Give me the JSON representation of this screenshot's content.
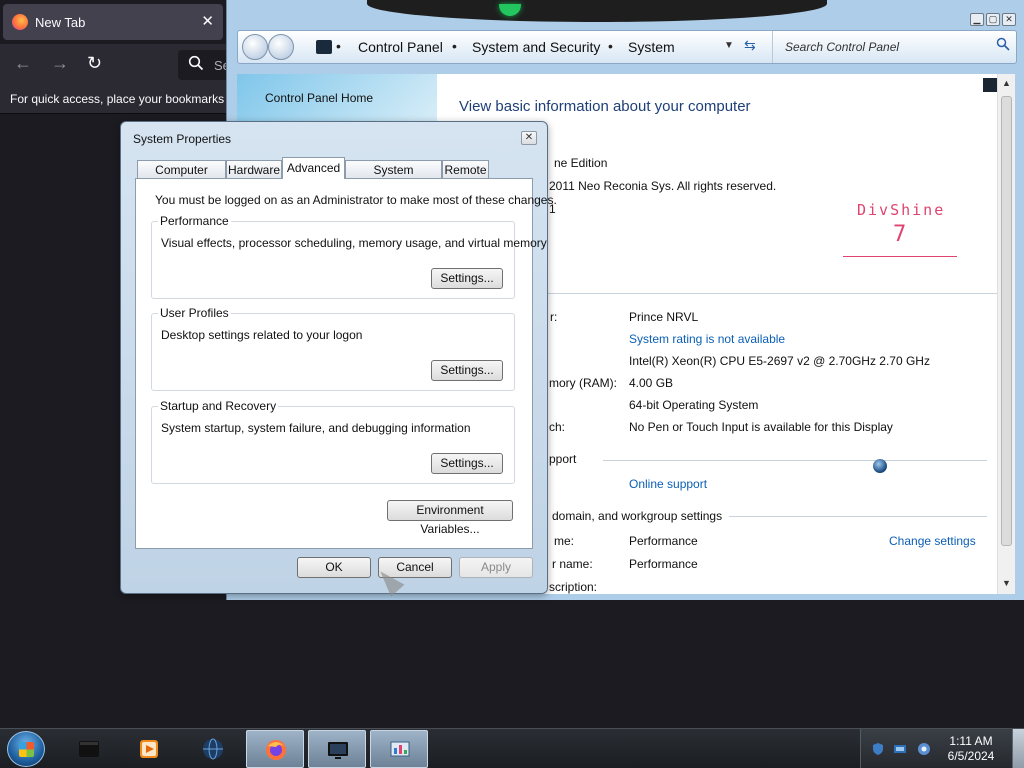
{
  "firefox": {
    "tab_title": "New Tab",
    "tab_close": "✕",
    "search_partial": "Se",
    "bookmarks_hint": "For quick access, place your bookmarks h"
  },
  "control_panel": {
    "breadcrumbs": [
      "Control Panel",
      "System and Security",
      "System"
    ],
    "search_placeholder": "Search Control Panel",
    "left_nav": {
      "home": "Control Panel Home"
    },
    "heading": "View basic information about your computer",
    "edition_fragment": "ne Edition",
    "copyright_fragment": "2011 Neo Reconia Sys.  All rights reserved.",
    "pack_fragment": "1",
    "logo": {
      "name": "DivShine",
      "version": "7"
    },
    "system_rows": [
      {
        "label": "r:",
        "value": "Prince NRVL",
        "link": false
      },
      {
        "label": "",
        "value": "System rating is not available",
        "link": true
      },
      {
        "label": "",
        "value": "Intel(R) Xeon(R) CPU E5-2697 v2 @ 2.70GHz   2.70 GHz",
        "link": false
      },
      {
        "label": "mory (RAM):",
        "value": "4.00 GB",
        "link": false
      },
      {
        "label": "",
        "value": "64-bit Operating System",
        "link": false
      },
      {
        "label": "ch:",
        "value": "No Pen or Touch Input is available for this Display",
        "link": false
      }
    ],
    "support_section": "pport",
    "support_link": "Online support",
    "domain_section": "domain, and workgroup settings",
    "domain_rows": [
      {
        "label": "me:",
        "value": "Performance"
      },
      {
        "label": "r name:",
        "value": "Performance"
      },
      {
        "label": "scription:",
        "value": ""
      }
    ],
    "change_settings": "Change settings"
  },
  "dialog": {
    "title": "System Properties",
    "tabs": [
      "Computer Name",
      "Hardware",
      "Advanced",
      "System Protection",
      "Remote"
    ],
    "active_tab": "Advanced",
    "admin_note": "You must be logged on as an Administrator to make most of these changes.",
    "groups": [
      {
        "title": "Performance",
        "desc": "Visual effects, processor scheduling, memory usage, and virtual memory",
        "button": "Settings..."
      },
      {
        "title": "User Profiles",
        "desc": "Desktop settings related to your logon",
        "button": "Settings..."
      },
      {
        "title": "Startup and Recovery",
        "desc": "System startup, system failure, and debugging information",
        "button": "Settings..."
      }
    ],
    "env_button": "Environment Variables...",
    "ok": "OK",
    "cancel": "Cancel",
    "apply": "Apply"
  },
  "taskbar": {
    "items": [
      "terminal-icon",
      "media-player-icon",
      "globe-icon",
      "firefox-icon",
      "monitor-icon",
      "control-panel-icon"
    ],
    "clock_time": "1:11 AM",
    "clock_date": "6/5/2024"
  }
}
